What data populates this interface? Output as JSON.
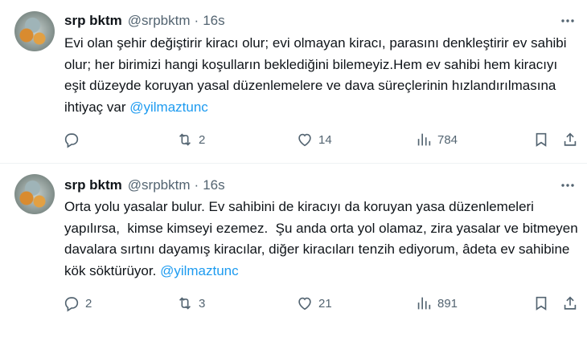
{
  "tweets": [
    {
      "name": "srp bktm",
      "handle": "@srpbktm",
      "separator": "·",
      "time": "16s",
      "text": "Evi olan şehir değiştirir kiracı olur; evi olmayan kiracı, parasını denkleştirir ev sahibi olur; her birimizi hangi koşulların beklediğini bilemeyiz.Hem ev sahibi hem kiracıyı eşit düzeyde koruyan yasal düzenlemelere ve dava süreçlerinin hızlandırılmasına ihtiyaç var ",
      "mention": "@yilmaztunc",
      "replies": "",
      "retweets": "2",
      "likes": "14",
      "views": "784"
    },
    {
      "name": "srp bktm",
      "handle": "@srpbktm",
      "separator": "·",
      "time": "16s",
      "text": "Orta yolu yasalar bulur. Ev sahibini de kiracıyı da koruyan yasa düzenlemeleri yapılırsa,  kimse kimseyi ezemez.  Şu anda orta yol olamaz, zira yasalar ve bitmeyen davalara sırtını dayamış kiracılar, diğer kiracıları tenzih ediyorum, âdeta ev sahibine kök söktürüyor. ",
      "mention": "@yilmaztunc",
      "replies": "2",
      "retweets": "3",
      "likes": "21",
      "views": "891"
    }
  ],
  "icons": {
    "more": "more-dots-icon",
    "reply": "reply-icon",
    "retweet": "retweet-icon",
    "like": "heart-icon",
    "views": "views-icon",
    "bookmark": "bookmark-icon",
    "share": "share-icon"
  },
  "colors": {
    "text": "#0f1419",
    "secondary": "#536471",
    "link": "#1d9bf0",
    "divider": "#eff3f4"
  }
}
